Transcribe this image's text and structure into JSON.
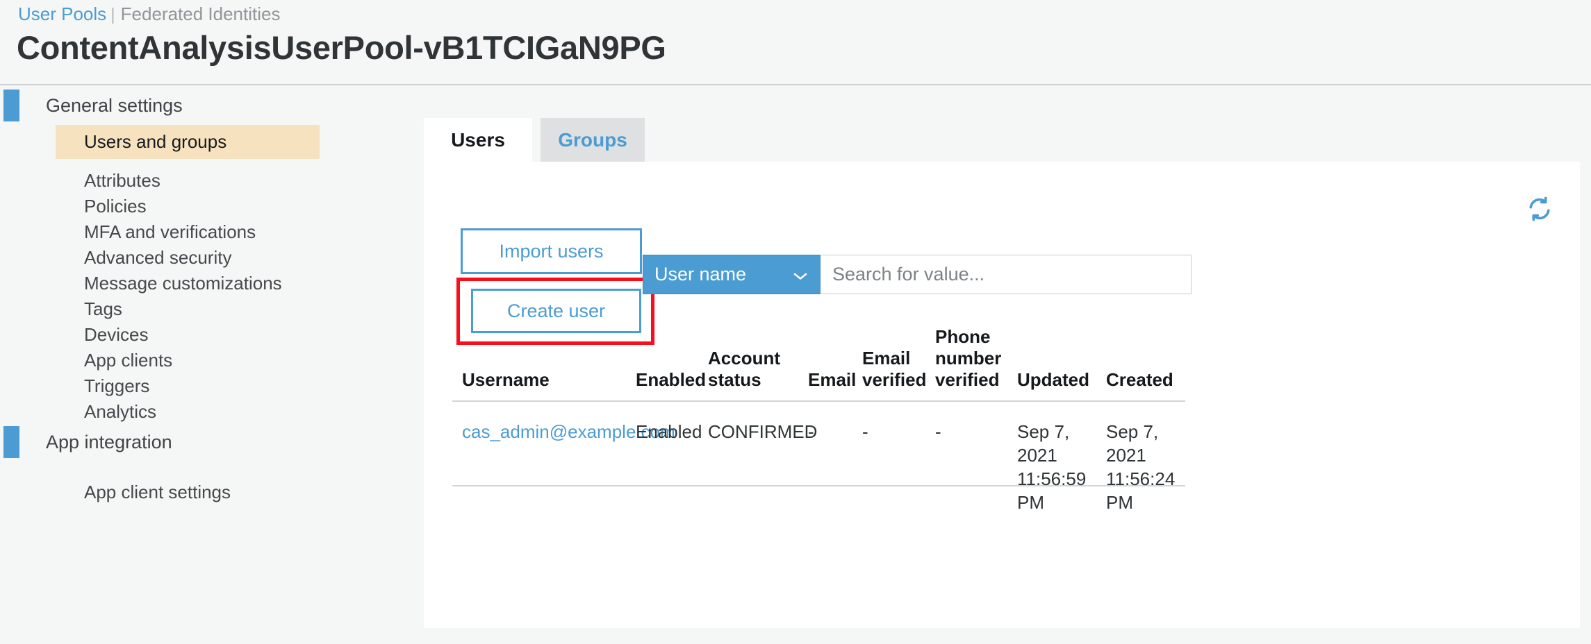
{
  "header": {
    "breadcrumb": {
      "active": "User Pools",
      "separator": "|",
      "inactive": "Federated Identities"
    },
    "pool_title": "ContentAnalysisUserPool-vB1TCIGaN9PG"
  },
  "sidebar": {
    "groups": [
      {
        "label": "General settings",
        "items": [
          {
            "label": "Users and groups",
            "selected": true
          },
          {
            "label": "Attributes",
            "selected": false
          },
          {
            "label": "Policies",
            "selected": false
          },
          {
            "label": "MFA and verifications",
            "selected": false
          },
          {
            "label": "Advanced security",
            "selected": false
          },
          {
            "label": "Message customizations",
            "selected": false
          },
          {
            "label": "Tags",
            "selected": false
          },
          {
            "label": "Devices",
            "selected": false
          },
          {
            "label": "App clients",
            "selected": false
          },
          {
            "label": "Triggers",
            "selected": false
          },
          {
            "label": "Analytics",
            "selected": false
          }
        ]
      },
      {
        "label": "App integration",
        "items": [
          {
            "label": "App client settings",
            "selected": false
          }
        ]
      }
    ]
  },
  "main": {
    "tabs": [
      {
        "label": "Users",
        "active": true
      },
      {
        "label": "Groups",
        "active": false
      }
    ],
    "toolbar": {
      "import_users_label": "Import users",
      "create_user_label": "Create user",
      "refresh_icon": "refresh-icon"
    },
    "search": {
      "filter_value": "User name",
      "chevron": "⌄",
      "placeholder": "Search for value..."
    },
    "table": {
      "columns": [
        "Username",
        "Enabled",
        "Account status",
        "Email",
        "Email verified",
        "Phone number verified",
        "Updated",
        "Created"
      ],
      "rows": [
        {
          "username": "cas_admin@example.com",
          "enabled": "Enabled",
          "account_status": "CONFIRMED",
          "email": "-",
          "email_verified": "-",
          "phone_number_verified": "-",
          "updated": "Sep 7, 2021 11:56:59 PM",
          "created": "Sep 7, 2021 11:56:24 PM"
        }
      ]
    }
  },
  "colors": {
    "accent_blue": "#4b9cd3",
    "selected_nav": "#f7e2bf",
    "annotation_red": "#fc0d1b",
    "page_bg": "#f5f6f6"
  }
}
